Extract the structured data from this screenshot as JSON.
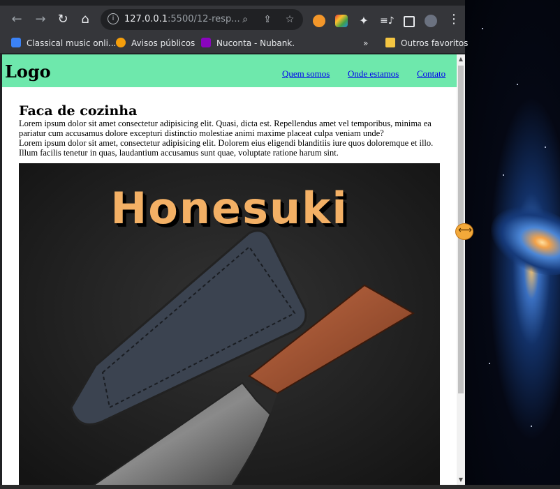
{
  "browser": {
    "url_host": "127.0.0.1",
    "url_rest": ":5500/12-resp...",
    "bookmarks": [
      {
        "label": "Classical music onli...",
        "icon": "music-bookmark-icon",
        "color": "#3b82f6"
      },
      {
        "label": "Avisos públicos",
        "icon": "avisos-bookmark-icon",
        "color": "#f59e0b"
      },
      {
        "label": "Nuconta - Nubank.",
        "icon": "nubank-bookmark-icon",
        "color": "#8a05be"
      }
    ],
    "more_bookmarks": "»",
    "other_favorites": "Outros favoritos"
  },
  "site": {
    "logo": "Logo",
    "nav": [
      "Quem somos",
      "Onde estamos",
      "Contato"
    ],
    "title": "Faca de cozinha",
    "paragraphs": [
      "Lorem ipsum dolor sit amet consectetur adipisicing elit. Quasi, dicta est. Repellendus amet vel temporibus, minima ea pariatur cum accusamus dolore excepturi distinctio molestiae animi maxime placeat culpa veniam unde?",
      "Lorem ipsum dolor sit amet, consectetur adipisicing elit. Dolorem eius eligendi blanditiis iure quos doloremque et illo. Illum facilis tenetur in quas, laudantium accusamus sunt quae, voluptate ratione harum sint."
    ],
    "hero_title": "Honesuki"
  },
  "colors": {
    "header_bg": "#6ee8ac",
    "link": "#0000ee",
    "hero_title": "#f3b065"
  }
}
